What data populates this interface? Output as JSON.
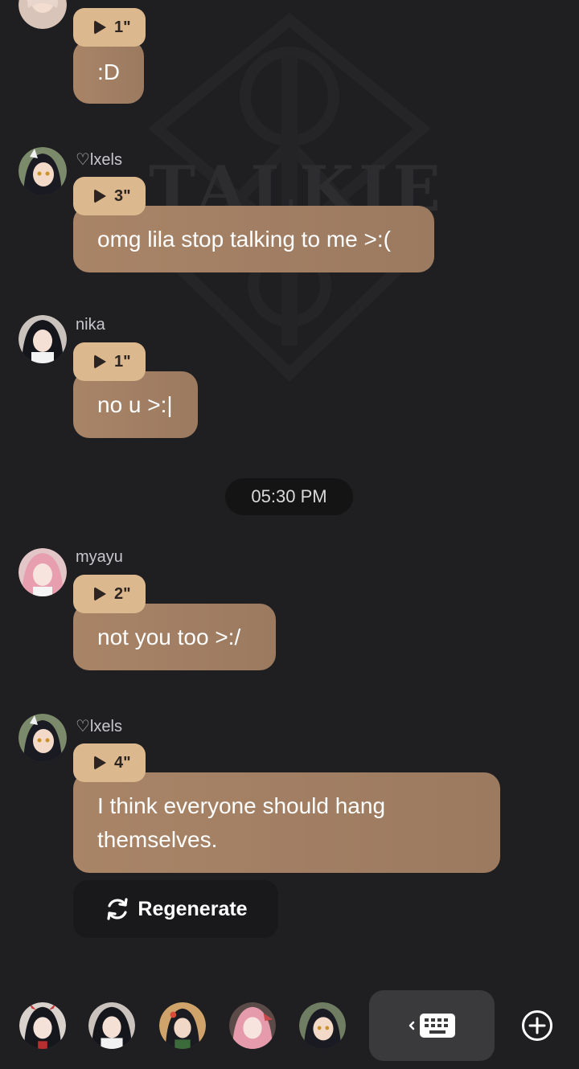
{
  "messages": [
    {
      "user": "",
      "duration": "1\"",
      "text": ":D"
    },
    {
      "user": "♡lxels",
      "duration": "3\"",
      "text": "omg lila stop talking to me >:("
    },
    {
      "user": "nika",
      "duration": "1\"",
      "text": "no u >:|"
    },
    {
      "user": "myayu",
      "duration": "2\"",
      "text": "not you too >:/"
    },
    {
      "user": "♡lxels",
      "duration": "4\"",
      "text_line1": "I think everyone should hang",
      "text_line2": "themselves."
    }
  ],
  "time_divider": "05:30 PM",
  "regenerate_label": "Regenerate",
  "watermark_text": "TALKIE",
  "colors": {
    "background": "#1f1f21",
    "bubble": "#a98467",
    "duration_pill": "#dcb88e",
    "time_chip": "#141414",
    "keyboard_button": "#3a3a3d"
  },
  "icons": {
    "play": "play-icon",
    "regenerate": "refresh-icon",
    "keyboard": "keyboard-icon",
    "add": "plus-circle-icon"
  }
}
